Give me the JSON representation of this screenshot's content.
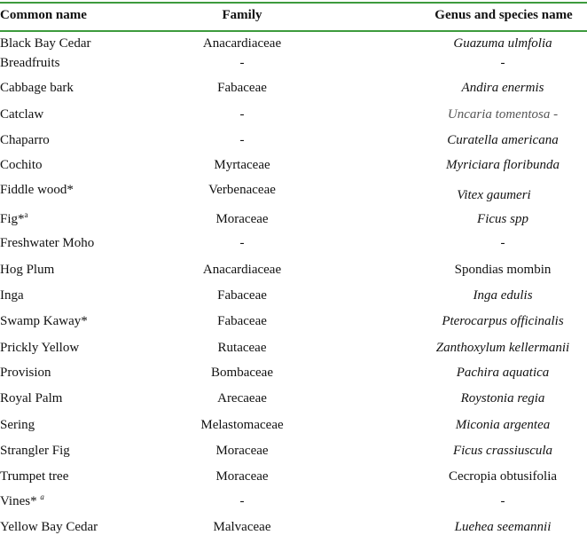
{
  "table": {
    "headers": {
      "common": "Common name",
      "family": "Family",
      "species": "Genus and species name"
    },
    "rule_color": "#3d9b3d",
    "rows": [
      {
        "common": "Black Bay Cedar",
        "sup": "",
        "family": "Anacardiaceae",
        "species": "Guazuma ulmfolia",
        "italic": true
      },
      {
        "common": "Breadfruits",
        "sup": "",
        "family": "-",
        "species": "-",
        "italic": false
      },
      {
        "common": "Cabbage bark",
        "sup": "",
        "family": "Fabaceae",
        "species": "Andira enermis",
        "italic": true
      },
      {
        "common": "Catclaw",
        "sup": "",
        "family": "-",
        "species": "Uncaria tomentosa -",
        "italic": true,
        "grey": true
      },
      {
        "common": "Chaparro",
        "sup": "",
        "family": "-",
        "species": "Curatella americana",
        "italic": true
      },
      {
        "common": "Cochito",
        "sup": "",
        "family": "Myrtaceae",
        "species": "Myriciara floribunda",
        "italic": true
      },
      {
        "common": "Fiddle wood*",
        "sup": "",
        "family": "Verbenaceae",
        "species": "Vitex gaumeri",
        "italic": true,
        "shift": true
      },
      {
        "common": "Fig*",
        "sup": "a",
        "family": "Moraceae",
        "species": "Ficus spp",
        "italic": true
      },
      {
        "common": "Freshwater Moho",
        "sup": "",
        "family": "-",
        "species": "-",
        "italic": false
      },
      {
        "common": "Hog Plum",
        "sup": "",
        "family": "Anacardiaceae",
        "species": "Spondias mombin",
        "italic": false
      },
      {
        "common": "Inga",
        "sup": "",
        "family": "Fabaceae",
        "species": "Inga edulis",
        "italic": true
      },
      {
        "common": "Swamp Kaway*",
        "sup": "",
        "family": "Fabaceae",
        "species": "Pterocarpus officinalis",
        "italic": true
      },
      {
        "common": "Prickly Yellow",
        "sup": "",
        "family": "Rutaceae",
        "species": "Zanthoxylum kellermanii",
        "italic": true
      },
      {
        "common": "Provision",
        "sup": "",
        "family": "Bombaceae",
        "species": "Pachira aquatica",
        "italic": true
      },
      {
        "common": "Royal Palm",
        "sup": "",
        "family": "Arecaeae",
        "species": "Roystonia regia",
        "italic": true
      },
      {
        "common": "Sering",
        "sup": "",
        "family": "Melastomaceae",
        "species": "Miconia argentea",
        "italic": true
      },
      {
        "common": "Strangler Fig",
        "sup": "",
        "family": "Moraceae",
        "species": "Ficus crassiuscula",
        "italic": true
      },
      {
        "common": "Trumpet tree",
        "sup": "",
        "family": "Moraceae",
        "species": "Cecropia obtusifolia",
        "italic": false
      },
      {
        "common": "Vines* ",
        "sup": "a",
        "supItalic": true,
        "family": "-",
        "species": "-",
        "italic": false
      },
      {
        "common": "Yellow Bay Cedar",
        "sup": "",
        "family": "Malvaceae",
        "species": "Luehea seemannii",
        "italic": true
      }
    ]
  }
}
